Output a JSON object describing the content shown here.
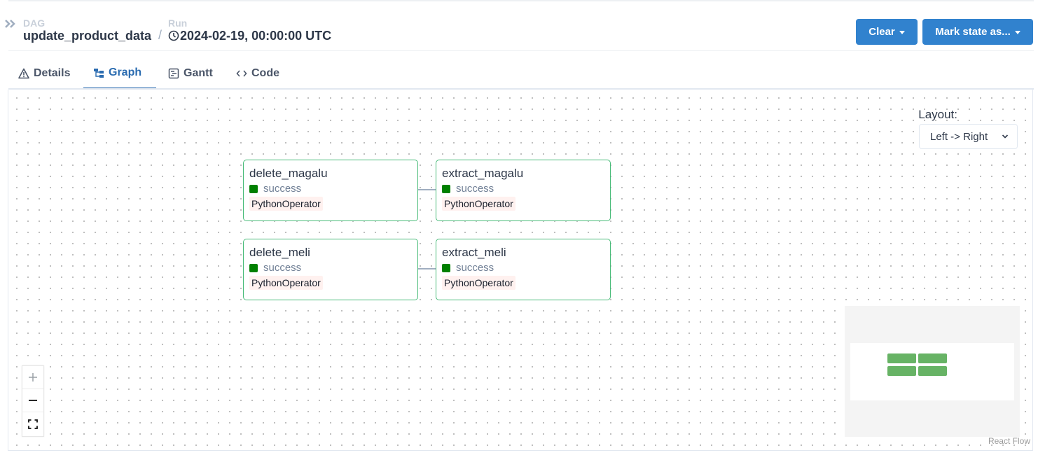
{
  "header": {
    "dag_label": "DAG",
    "dag_name": "update_product_data",
    "separator": "/",
    "run_label": "Run",
    "run_id": "2024-02-19, 00:00:00 UTC",
    "clear_label": "Clear",
    "mark_state_label": "Mark state as..."
  },
  "tabs": [
    {
      "label": "Details",
      "icon": "warning-icon",
      "active": false
    },
    {
      "label": "Graph",
      "icon": "graph-icon",
      "active": true
    },
    {
      "label": "Gantt",
      "icon": "gantt-icon",
      "active": false
    },
    {
      "label": "Code",
      "icon": "code-icon",
      "active": false
    }
  ],
  "graph": {
    "layout_label": "Layout:",
    "layout_value": "Left -> Right",
    "nodes": [
      {
        "name": "delete_magalu",
        "state": "success",
        "operator": "PythonOperator"
      },
      {
        "name": "extract_magalu",
        "state": "success",
        "operator": "PythonOperator"
      },
      {
        "name": "delete_meli",
        "state": "success",
        "operator": "PythonOperator"
      },
      {
        "name": "extract_meli",
        "state": "success",
        "operator": "PythonOperator"
      }
    ],
    "edges": [
      {
        "from": "delete_magalu",
        "to": "extract_magalu"
      },
      {
        "from": "delete_meli",
        "to": "extract_meli"
      }
    ],
    "attribution": "React Flow"
  },
  "colors": {
    "primary": "#3182ce",
    "success": "#008000",
    "node_border": "#48bb78",
    "operator_bg": "#fff1ef"
  }
}
